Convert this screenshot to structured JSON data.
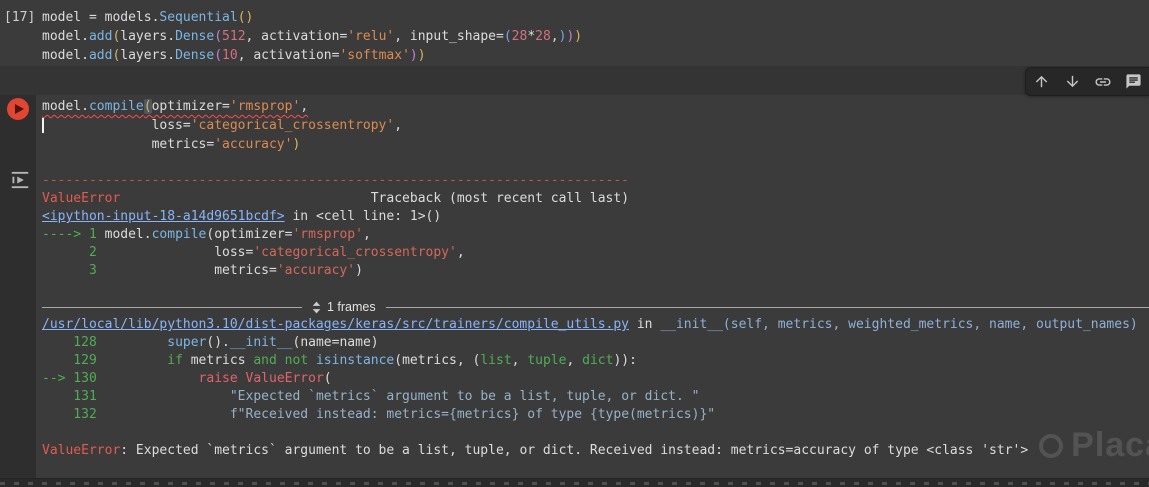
{
  "colors": {
    "plain": "#dcdcdc",
    "func": "#7cb6e4",
    "str": "#dd8b50",
    "num": "#d4707f",
    "b1": "#d9b75c",
    "b2": "#c47fd4",
    "b3": "#7aa7e0",
    "sep": "#bb5a42",
    "red": "#e25b50",
    "green": "#4fae54",
    "link": "#8ab4f8",
    "pathsig": "#8fb0d8",
    "tbstr": "#d4685a",
    "framestr": "#96b2c8",
    "kwred": "#e0646a"
  },
  "cell1": {
    "exec_count": "[17]",
    "code": [
      {
        "type": "code",
        "segs": [
          {
            "t": "model = models.",
            "c": "plain"
          },
          {
            "t": "Sequential",
            "c": "func"
          },
          {
            "t": "()",
            "c": "b1"
          }
        ]
      },
      {
        "type": "code",
        "segs": [
          {
            "t": "model.",
            "c": "plain"
          },
          {
            "t": "add",
            "c": "func"
          },
          {
            "t": "(",
            "c": "b1"
          },
          {
            "t": "layers.",
            "c": "plain"
          },
          {
            "t": "Dense",
            "c": "func"
          },
          {
            "t": "(",
            "c": "b2"
          },
          {
            "t": "512",
            "c": "num"
          },
          {
            "t": ", activation=",
            "c": "plain"
          },
          {
            "t": "'relu'",
            "c": "str"
          },
          {
            "t": ", input_shape=",
            "c": "plain"
          },
          {
            "t": "(",
            "c": "b3"
          },
          {
            "t": "28",
            "c": "num"
          },
          {
            "t": "*",
            "c": "plain"
          },
          {
            "t": "28",
            "c": "num"
          },
          {
            "t": ",",
            "c": "plain"
          },
          {
            "t": ")",
            "c": "b3"
          },
          {
            "t": ")",
            "c": "b2"
          },
          {
            "t": ")",
            "c": "b1"
          }
        ]
      },
      {
        "type": "code",
        "segs": [
          {
            "t": "model.",
            "c": "plain"
          },
          {
            "t": "add",
            "c": "func"
          },
          {
            "t": "(",
            "c": "b1"
          },
          {
            "t": "layers.",
            "c": "plain"
          },
          {
            "t": "Dense",
            "c": "func"
          },
          {
            "t": "(",
            "c": "b2"
          },
          {
            "t": "10",
            "c": "num"
          },
          {
            "t": ", activation=",
            "c": "plain"
          },
          {
            "t": "'softmax'",
            "c": "str"
          },
          {
            "t": ")",
            "c": "b2"
          },
          {
            "t": ")",
            "c": "b1"
          }
        ]
      }
    ]
  },
  "toolbar": {
    "icons": [
      {
        "name": "move-cell-up"
      },
      {
        "name": "move-cell-down"
      },
      {
        "name": "copy-link-to-cell"
      },
      {
        "name": "add-comment"
      }
    ]
  },
  "cell2": {
    "status": "error",
    "code": [
      {
        "type": "code",
        "cls": "squiggle",
        "segs": [
          {
            "t": "model.",
            "c": "plain"
          },
          {
            "t": "compile",
            "c": "func"
          },
          {
            "t": "(",
            "c": "b1",
            "cls": "match"
          },
          {
            "t": "optimizer=",
            "c": "plain"
          },
          {
            "t": "'rmsprop'",
            "c": "str"
          },
          {
            "t": ",",
            "c": "plain"
          }
        ]
      },
      {
        "type": "code",
        "segs": [
          {
            "cls": "cursor"
          },
          {
            "t": "              loss=",
            "c": "plain"
          },
          {
            "t": "'categorical_crossentropy'",
            "c": "str"
          },
          {
            "t": ",",
            "c": "plain"
          }
        ]
      },
      {
        "type": "code",
        "segs": [
          {
            "t": "              metrics=",
            "c": "plain"
          },
          {
            "t": "'accuracy'",
            "c": "str"
          },
          {
            "t": ")",
            "c": "b1"
          }
        ]
      }
    ]
  },
  "output": {
    "lines": [
      {
        "type": "code",
        "segs": [
          {
            "t": "---------------------------------------------------------------------------",
            "c": "sep"
          }
        ]
      },
      {
        "type": "code",
        "segs": [
          {
            "t": "ValueError",
            "c": "red"
          },
          {
            "t": "                                Traceback (most recent call last)",
            "c": "plain"
          }
        ]
      },
      {
        "type": "code",
        "segs": [
          {
            "t": "<ipython-input-18-a14d9651bcdf>",
            "c": "link",
            "u": true
          },
          {
            "t": " in <cell line: 1>()",
            "c": "plain"
          }
        ]
      },
      {
        "type": "code",
        "segs": [
          {
            "t": "----> 1 ",
            "c": "green"
          },
          {
            "t": "model.",
            "c": "plain"
          },
          {
            "t": "compile",
            "c": "func"
          },
          {
            "t": "(optimizer=",
            "c": "plain"
          },
          {
            "t": "'rmsprop'",
            "c": "tbstr"
          },
          {
            "t": ",",
            "c": "plain"
          }
        ]
      },
      {
        "type": "code",
        "segs": [
          {
            "t": "      2 ",
            "c": "green"
          },
          {
            "t": "              loss=",
            "c": "plain"
          },
          {
            "t": "'categorical_crossentropy'",
            "c": "tbstr"
          },
          {
            "t": ",",
            "c": "plain"
          }
        ]
      },
      {
        "type": "code",
        "segs": [
          {
            "t": "      3 ",
            "c": "green"
          },
          {
            "t": "              metrics=",
            "c": "plain"
          },
          {
            "t": "'accuracy'",
            "c": "tbstr"
          },
          {
            "t": ")",
            "c": "plain"
          }
        ]
      },
      {
        "type": "blank"
      },
      {
        "type": "frames",
        "label": "1 frames"
      },
      {
        "type": "code",
        "segs": [
          {
            "t": "/usr/local/lib/python3.10/dist-packages/keras/src/trainers/compile_utils.py",
            "c": "link",
            "u": true
          },
          {
            "t": " in ",
            "c": "plain"
          },
          {
            "t": "__init__(self, metrics, weighted_metrics, name, output_names)",
            "c": "pathsig"
          }
        ]
      },
      {
        "type": "code",
        "segs": [
          {
            "t": "    128 ",
            "c": "green"
          },
          {
            "t": "        ",
            "c": "plain"
          },
          {
            "t": "super",
            "c": "func"
          },
          {
            "t": "().",
            "c": "plain"
          },
          {
            "t": "__init__",
            "c": "func"
          },
          {
            "t": "(name=name)",
            "c": "plain"
          }
        ]
      },
      {
        "type": "code",
        "segs": [
          {
            "t": "    129 ",
            "c": "green"
          },
          {
            "t": "        ",
            "c": "plain"
          },
          {
            "t": "if",
            "c": "green"
          },
          {
            "t": " metrics ",
            "c": "plain"
          },
          {
            "t": "and",
            "c": "green"
          },
          {
            "t": " ",
            "c": "plain"
          },
          {
            "t": "not",
            "c": "green"
          },
          {
            "t": " ",
            "c": "plain"
          },
          {
            "t": "isinstance",
            "c": "func"
          },
          {
            "t": "(metrics, (",
            "c": "plain"
          },
          {
            "t": "list",
            "c": "green"
          },
          {
            "t": ", ",
            "c": "plain"
          },
          {
            "t": "tuple",
            "c": "green"
          },
          {
            "t": ", ",
            "c": "plain"
          },
          {
            "t": "dict",
            "c": "green"
          },
          {
            "t": ")):",
            "c": "plain"
          }
        ]
      },
      {
        "type": "code",
        "segs": [
          {
            "t": "--> 130 ",
            "c": "green"
          },
          {
            "t": "            ",
            "c": "plain"
          },
          {
            "t": "raise",
            "c": "kwred"
          },
          {
            "t": " ",
            "c": "plain"
          },
          {
            "t": "ValueError",
            "c": "kwred"
          },
          {
            "t": "(",
            "c": "plain"
          }
        ]
      },
      {
        "type": "code",
        "segs": [
          {
            "t": "    131 ",
            "c": "green"
          },
          {
            "t": "                ",
            "c": "plain"
          },
          {
            "t": "\"Expected `metrics` argument to be a list, tuple, or dict. \"",
            "c": "framestr"
          }
        ]
      },
      {
        "type": "code",
        "segs": [
          {
            "t": "    132 ",
            "c": "green"
          },
          {
            "t": "                ",
            "c": "plain"
          },
          {
            "t": "f\"Received instead: metrics={metrics} of type {type(metrics)}\"",
            "c": "framestr"
          }
        ]
      },
      {
        "type": "blank"
      },
      {
        "type": "code",
        "segs": [
          {
            "t": "ValueError",
            "c": "red"
          },
          {
            "t": ": Expected `metrics` argument to be a list, tuple, or dict. Received instead: metrics=accuracy of type <class 'str'>",
            "c": "plain"
          }
        ]
      }
    ]
  },
  "watermark": {
    "text": "Placa"
  }
}
